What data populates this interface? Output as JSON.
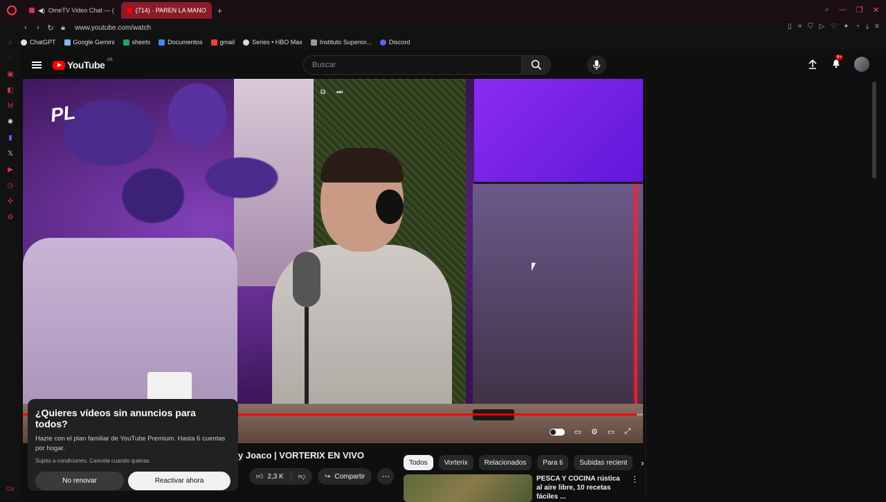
{
  "browser": {
    "tabs": [
      {
        "label": "OmeTV Video Chat — (",
        "active": false
      },
      {
        "label": "(714) · PAREN LA MANO",
        "active": true
      }
    ],
    "new_tab": "+",
    "url": "www.youtube.com/watch",
    "bookmarks": [
      {
        "label": "ChatGPT",
        "color": "#e0e0e0"
      },
      {
        "label": "Google Gemini",
        "color": "#8ab4f8"
      },
      {
        "label": "sheets",
        "color": "#1fa463"
      },
      {
        "label": "Documentos",
        "color": "#4285f4"
      },
      {
        "label": "gmail",
        "color": "#ea4335"
      },
      {
        "label": "Series • HBO Max",
        "color": "#dddddd"
      },
      {
        "label": "Instituto Superior...",
        "color": "#9a9a9a"
      },
      {
        "label": "Discord",
        "color": "#5865f2"
      }
    ],
    "accent": "#ff3b4f"
  },
  "youtube": {
    "logo_text": "YouTube",
    "region": "AR",
    "search_placeholder": "Buscar",
    "notification_count": "9+",
    "video": {
      "title": "y Joaco | VORTERIX EN VIVO",
      "progress": 0.99,
      "likes": "2,3 K",
      "share_label": "Compartir",
      "overlay_logo": "PL"
    },
    "chips": [
      "Todos",
      "Vorterix",
      "Relacionados",
      "Para ti",
      "Subidas recient"
    ],
    "recommended": [
      {
        "title": "PESCA Y COCINA rústica al aire libre, 10 recetas fáciles ..."
      }
    ],
    "promo": {
      "title": "¿Quieres vídeos sin anuncios para todos?",
      "body": "Hazte con el plan familiar de YouTube Premium. Hasta 6 cuentas por hogar.",
      "small": "Sujeto a condiciones. Cancela cuando quieras.",
      "decline": "No renovar",
      "accept": "Reactivar ahora"
    }
  }
}
